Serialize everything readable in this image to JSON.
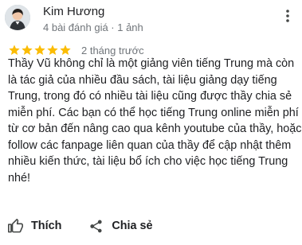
{
  "review": {
    "author_name": "Kim Hương",
    "author_meta": "4 bài đánh giá · 1 ảnh",
    "rating": 5,
    "rating_max": 5,
    "time": "2 tháng trước",
    "text_lines": [
      "Thầy Vũ không chỉ là một giảng viên tiếng Trung mà còn",
      "là tác giả của nhiều đầu sách, tài liệu giảng dạy tiếng",
      "Trung, trong đó có nhiều tài liệu cũng được thầy chia sẻ",
      "miễn phí. Các bạn có thể học tiếng Trung online miễn phí",
      "từ cơ bản đến nâng cao qua kênh youtube của thầy, hoặc",
      "follow các fanpage liên quan của thầy để cập nhật thêm",
      "nhiều kiến thức, tài liệu bổ ích cho việc học tiếng Trung",
      "nhé!"
    ]
  },
  "actions": {
    "like_label": "Thích",
    "share_label": "Chia sẻ"
  },
  "icons": {
    "avatar": "avatar-photo",
    "more": "more-vertical-icon",
    "star": "star-icon",
    "like": "thumb-up-icon",
    "share": "share-icon"
  },
  "colors": {
    "star": "#fbbc04",
    "text_primary": "#202124",
    "text_secondary": "#70757a",
    "icon": "#444746"
  }
}
